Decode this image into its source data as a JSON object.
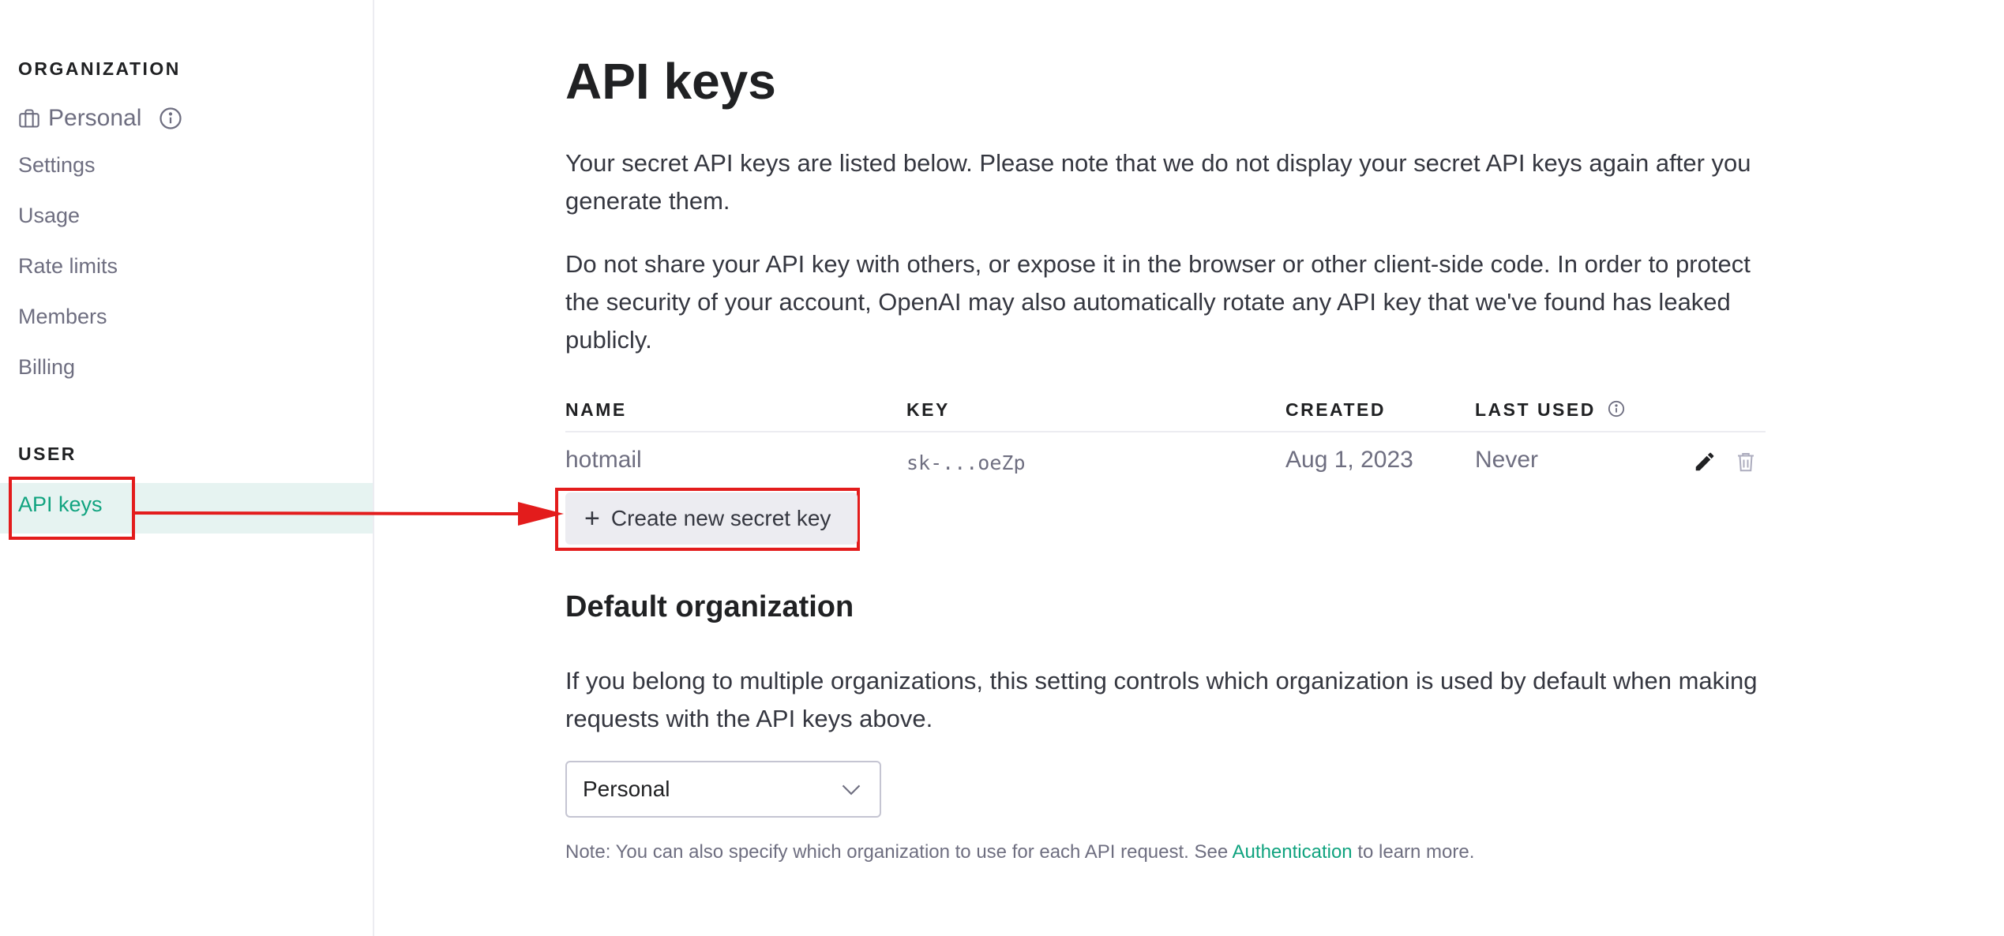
{
  "sidebar": {
    "organization_heading": "ORGANIZATION",
    "org_name": "Personal",
    "items": [
      {
        "label": "Settings"
      },
      {
        "label": "Usage"
      },
      {
        "label": "Rate limits"
      },
      {
        "label": "Members"
      },
      {
        "label": "Billing"
      }
    ],
    "user_heading": "USER",
    "active_item": "API keys"
  },
  "main": {
    "title": "API keys",
    "intro_1": "Your secret API keys are listed below. Please note that we do not display your secret API keys again after you generate them.",
    "intro_2": "Do not share your API key with others, or expose it in the browser or other client-side code. In order to protect the security of your account, OpenAI may also automatically rotate any API key that we've found has leaked publicly.",
    "table": {
      "headers": {
        "name": "NAME",
        "key": "KEY",
        "created": "CREATED",
        "last_used": "LAST USED"
      },
      "rows": [
        {
          "name": "hotmail",
          "key": "sk-...oeZp",
          "created": "Aug 1, 2023",
          "last_used": "Never"
        }
      ]
    },
    "create_button": {
      "icon": "+",
      "label": "Create new secret key"
    },
    "default_org": {
      "title": "Default organization",
      "description": "If you belong to multiple organizations, this setting controls which organization is used by default when making requests with the API keys above.",
      "select_value": "Personal",
      "note_prefix": "Note: You can also specify which organization to use for each API request. See ",
      "note_link": "Authentication",
      "note_suffix": " to learn more."
    }
  },
  "colors": {
    "accent": "#10a37f",
    "annotation": "#e31c1c",
    "active_bg": "#e6f3f1",
    "button_bg": "#ececf1"
  },
  "icons": [
    "briefcase-icon",
    "info-icon",
    "plus-icon",
    "pencil-icon",
    "trash-icon",
    "chevron-down-icon",
    "arrow-annotation"
  ]
}
